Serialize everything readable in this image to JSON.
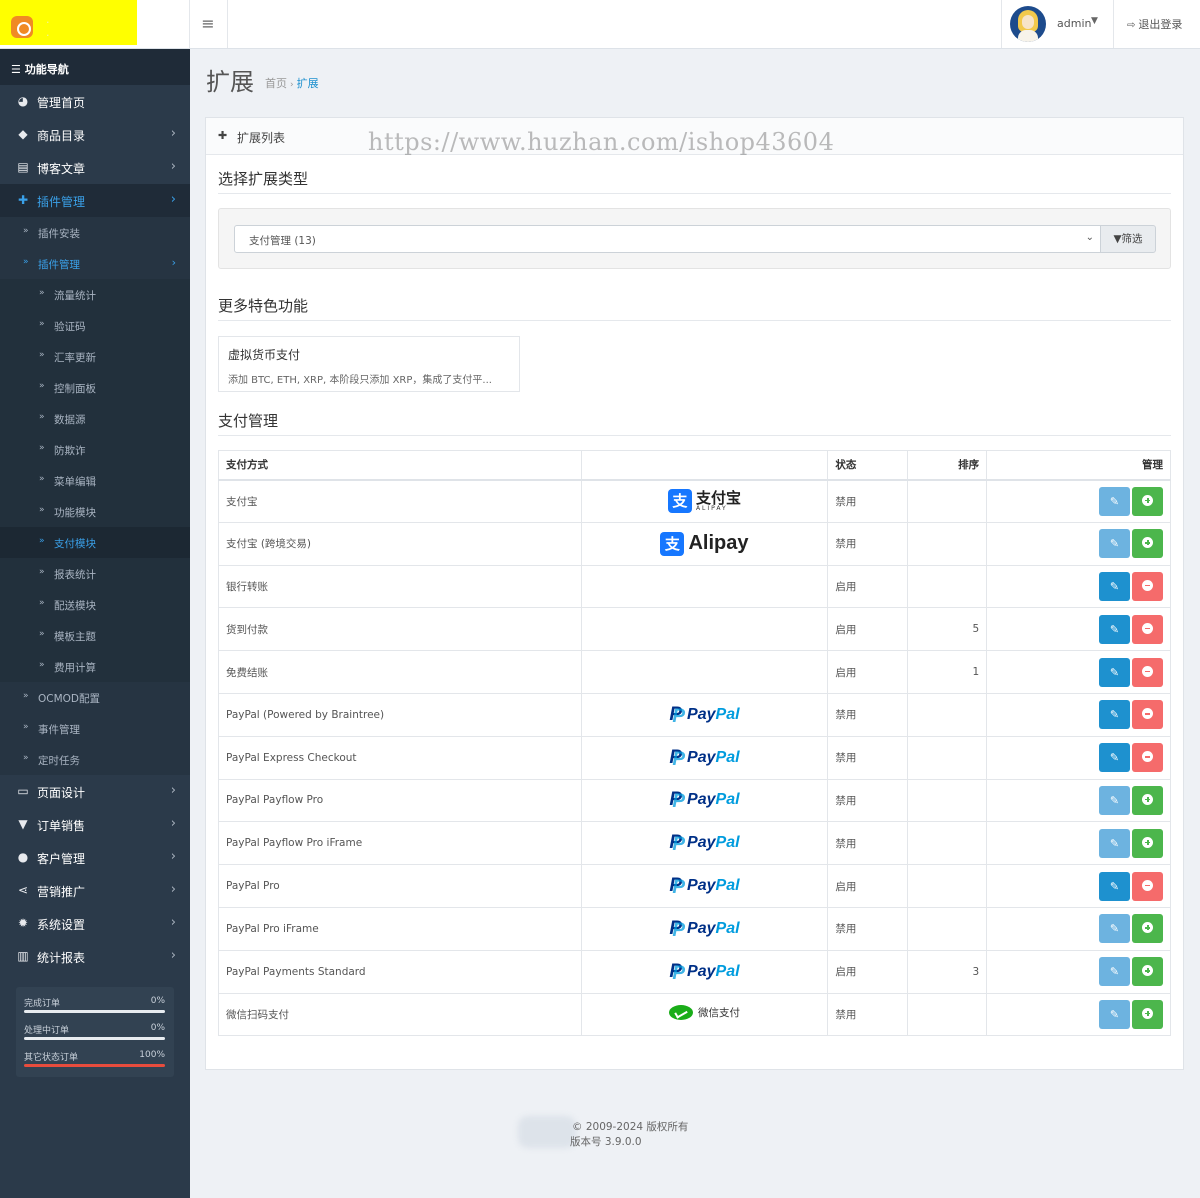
{
  "header": {
    "user_name": "admin",
    "logout_label": "退出登录"
  },
  "sidebar": {
    "nav_title": "功能导航",
    "items_top": [
      {
        "label": "管理首页",
        "icon": "dashboard-icon"
      },
      {
        "label": "商品目录",
        "icon": "tags-icon"
      },
      {
        "label": "博客文章",
        "icon": "newspaper-icon"
      },
      {
        "label": "插件管理",
        "icon": "puzzle-icon"
      }
    ],
    "plugin_sub": [
      {
        "label": "插件安装"
      },
      {
        "label": "插件管理"
      }
    ],
    "plugin_sub2": [
      {
        "label": "流量统计"
      },
      {
        "label": "验证码"
      },
      {
        "label": "汇率更新"
      },
      {
        "label": "控制面板"
      },
      {
        "label": "数据源"
      },
      {
        "label": "防欺诈"
      },
      {
        "label": "菜单编辑"
      },
      {
        "label": "功能模块"
      },
      {
        "label": "支付模块"
      },
      {
        "label": "报表统计"
      },
      {
        "label": "配送模块"
      },
      {
        "label": "模板主题"
      },
      {
        "label": "费用计算"
      }
    ],
    "plugin_sub_more": [
      {
        "label": "OCMOD配置"
      },
      {
        "label": "事件管理"
      },
      {
        "label": "定时任务"
      }
    ],
    "items_bottom": [
      {
        "label": "页面设计",
        "icon": "desktop-icon"
      },
      {
        "label": "订单销售",
        "icon": "cart-icon"
      },
      {
        "label": "客户管理",
        "icon": "user-icon"
      },
      {
        "label": "营销推广",
        "icon": "share-icon"
      },
      {
        "label": "系统设置",
        "icon": "gear-icon"
      },
      {
        "label": "统计报表",
        "icon": "bar-chart-icon"
      }
    ],
    "stats": [
      {
        "label": "完成订单",
        "value": "0%",
        "fraction": 0
      },
      {
        "label": "处理中订单",
        "value": "0%",
        "fraction": 0
      },
      {
        "label": "其它状态订单",
        "value": "100%",
        "fraction": 1
      }
    ]
  },
  "page": {
    "title": "扩展",
    "breadcrumb": [
      "首页",
      "扩展"
    ],
    "panel_title": "扩展列表",
    "watermark": "https://www.huzhan.com/ishop43604"
  },
  "filter": {
    "section_title": "选择扩展类型",
    "selected": "支付管理 (13)",
    "button_label": "筛选"
  },
  "features": {
    "section_title": "更多特色功能",
    "card_title": "虚拟货币支付",
    "card_desc": "添加 BTC, ETH, XRP, 本阶段只添加 XRP，集成了支付平..."
  },
  "payments": {
    "section_title": "支付管理",
    "columns": [
      "支付方式",
      "",
      "状态",
      "排序",
      "管理"
    ],
    "rows": [
      {
        "name": "支付宝",
        "logo": "alipay-cn",
        "status": "禁用",
        "sort": "",
        "installed": false
      },
      {
        "name": "支付宝 (跨境交易)",
        "logo": "alipay-en",
        "status": "禁用",
        "sort": "",
        "installed": false
      },
      {
        "name": "银行转账",
        "logo": "",
        "status": "启用",
        "sort": "",
        "installed": true
      },
      {
        "name": "货到付款",
        "logo": "",
        "status": "启用",
        "sort": "5",
        "installed": true
      },
      {
        "name": "免费结账",
        "logo": "",
        "status": "启用",
        "sort": "1",
        "installed": true
      },
      {
        "name": "PayPal (Powered by Braintree)",
        "logo": "paypal",
        "status": "禁用",
        "sort": "",
        "installed": true
      },
      {
        "name": "PayPal Express Checkout",
        "logo": "paypal",
        "status": "禁用",
        "sort": "",
        "installed": true
      },
      {
        "name": "PayPal Payflow Pro",
        "logo": "paypal",
        "status": "禁用",
        "sort": "",
        "installed": false
      },
      {
        "name": "PayPal Payflow Pro iFrame",
        "logo": "paypal",
        "status": "禁用",
        "sort": "",
        "installed": false
      },
      {
        "name": "PayPal Pro",
        "logo": "paypal",
        "status": "启用",
        "sort": "",
        "installed": true
      },
      {
        "name": "PayPal Pro iFrame",
        "logo": "paypal",
        "status": "禁用",
        "sort": "",
        "installed": false
      },
      {
        "name": "PayPal Payments Standard",
        "logo": "paypal",
        "status": "启用",
        "sort": "3",
        "installed": false
      },
      {
        "name": "微信扫码支付",
        "logo": "wechat",
        "status": "禁用",
        "sort": "",
        "installed": false
      }
    ],
    "logo_text": {
      "alipay_cn": "支付宝",
      "alipay_cn_sub": "ALIPAY",
      "alipay_en": "Alipay",
      "paypal_a": "Pay",
      "paypal_b": "Pal",
      "wechat": "微信支付"
    }
  },
  "footer": {
    "line1": "© 2009-2024 版权所有",
    "line2": "版本号 3.9.0.0"
  },
  "colors": {
    "sidebar_bg": "#2b3a4a",
    "accent": "#1e91cf",
    "success": "#4cb64c",
    "danger": "#f56b6b"
  }
}
